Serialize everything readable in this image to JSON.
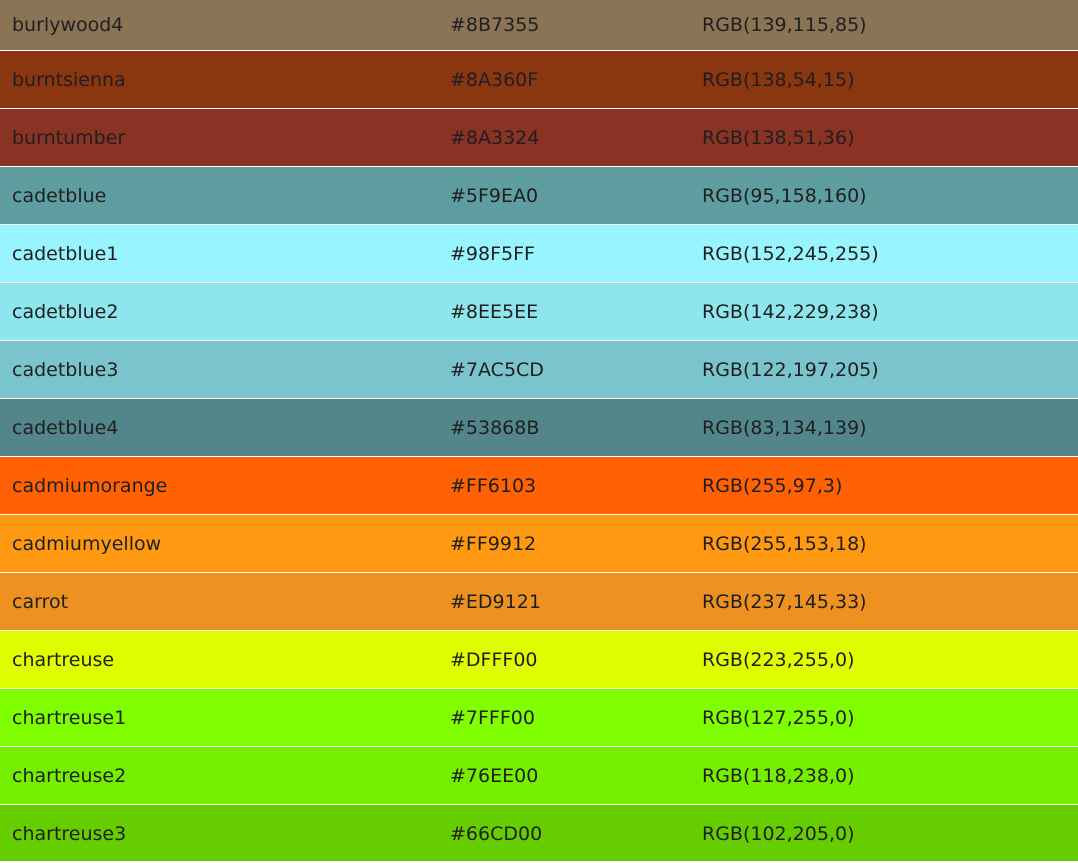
{
  "colors": [
    {
      "name": "burlywood4",
      "hex": "#8B7355",
      "rgb": "RGB(139,115,85)"
    },
    {
      "name": "burntsienna",
      "hex": "#8A360F",
      "rgb": "RGB(138,54,15)"
    },
    {
      "name": "burntumber",
      "hex": "#8A3324",
      "rgb": "RGB(138,51,36)"
    },
    {
      "name": "cadetblue",
      "hex": "#5F9EA0",
      "rgb": "RGB(95,158,160)"
    },
    {
      "name": "cadetblue1",
      "hex": "#98F5FF",
      "rgb": "RGB(152,245,255)"
    },
    {
      "name": "cadetblue2",
      "hex": "#8EE5EE",
      "rgb": "RGB(142,229,238)"
    },
    {
      "name": "cadetblue3",
      "hex": "#7AC5CD",
      "rgb": "RGB(122,197,205)"
    },
    {
      "name": "cadetblue4",
      "hex": "#53868B",
      "rgb": "RGB(83,134,139)"
    },
    {
      "name": "cadmiumorange",
      "hex": "#FF6103",
      "rgb": "RGB(255,97,3)"
    },
    {
      "name": "cadmiumyellow",
      "hex": "#FF9912",
      "rgb": "RGB(255,153,18)"
    },
    {
      "name": "carrot",
      "hex": "#ED9121",
      "rgb": "RGB(237,145,33)"
    },
    {
      "name": "chartreuse",
      "hex": "#DFFF00",
      "rgb": "RGB(223,255,0)"
    },
    {
      "name": "chartreuse1",
      "hex": "#7FFF00",
      "rgb": "RGB(127,255,0)"
    },
    {
      "name": "chartreuse2",
      "hex": "#76EE00",
      "rgb": "RGB(118,238,0)"
    },
    {
      "name": "chartreuse3",
      "hex": "#66CD00",
      "rgb": "RGB(102,205,0)"
    }
  ]
}
